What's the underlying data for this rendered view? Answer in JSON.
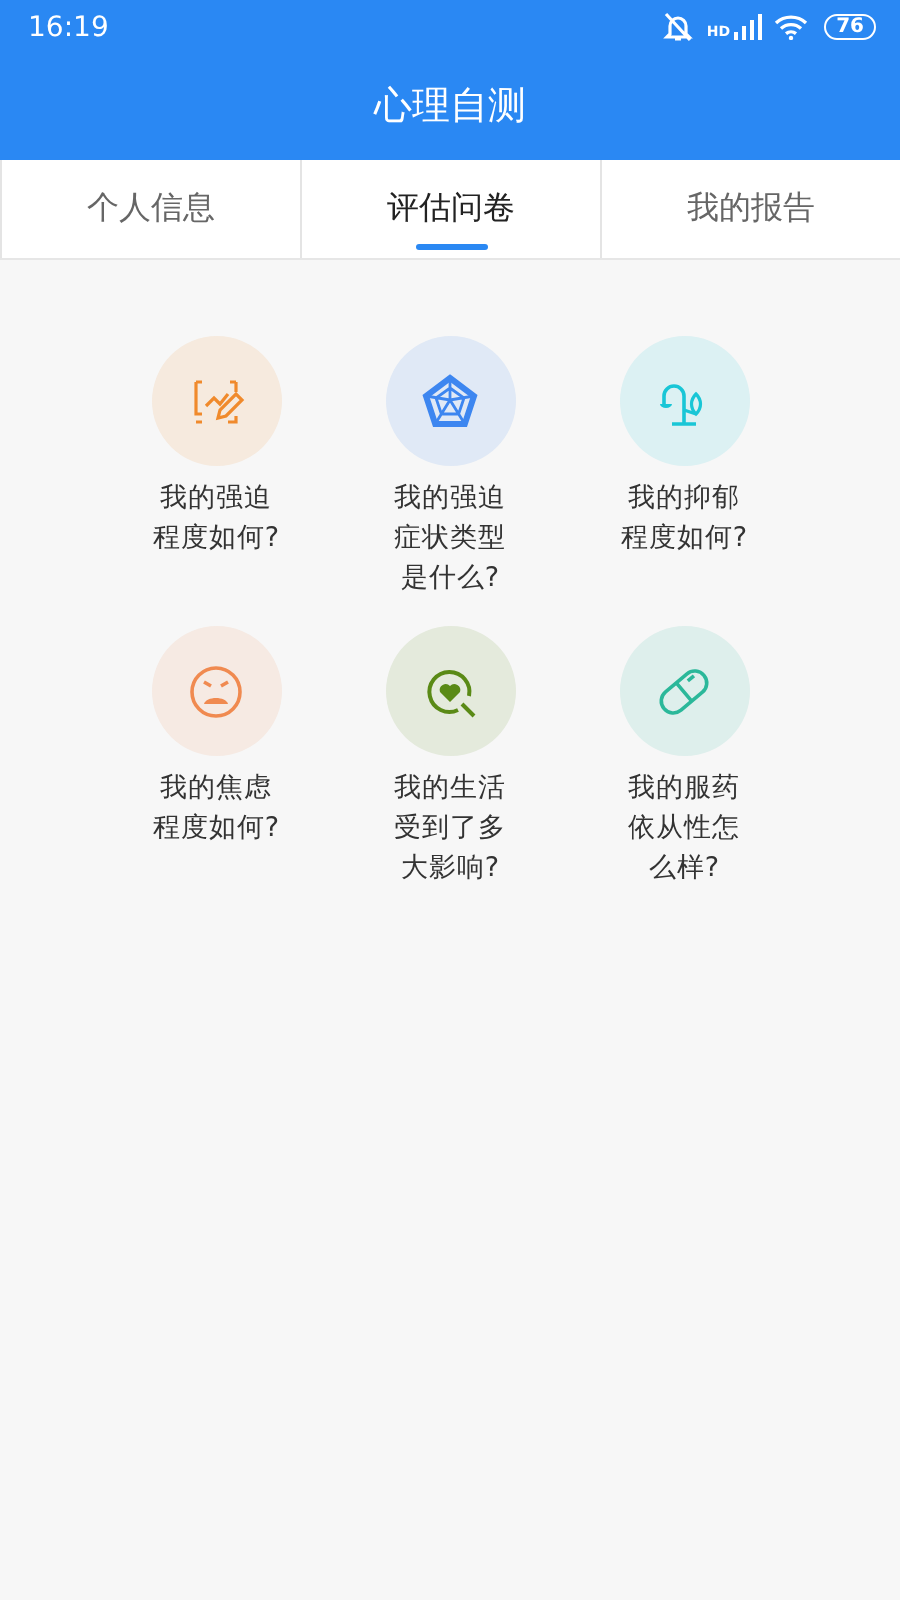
{
  "status_bar": {
    "time": "16:19",
    "network": "HD",
    "battery": "76"
  },
  "title": "心理自测",
  "tabs": [
    {
      "label": "个人信息",
      "selected": false
    },
    {
      "label": "评估问卷",
      "selected": true
    },
    {
      "label": "我的报告",
      "selected": false
    }
  ],
  "tests": [
    {
      "kind": "chart",
      "color": "#f08a2c",
      "label": "我的强迫程度如何?"
    },
    {
      "kind": "radar",
      "color": "#3d86f0",
      "label": "我的强迫症状类型是什么?"
    },
    {
      "kind": "lamp",
      "color": "#19c6d6",
      "label": "我的抑郁程度如何?"
    },
    {
      "kind": "face",
      "color": "#f08a50",
      "label": "我的焦虑程度如何?"
    },
    {
      "kind": "heart",
      "color": "#5a8a16",
      "label": "我的生活受到了多大影响?"
    },
    {
      "kind": "pill",
      "color": "#2bb89a",
      "label": "我的服药依从性怎么样?"
    }
  ]
}
